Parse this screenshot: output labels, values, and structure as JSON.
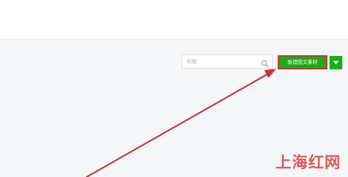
{
  "search": {
    "placeholder": "标题",
    "value": ""
  },
  "toolbar": {
    "new_label": "新建图文素材"
  },
  "icons": {
    "search": "search-icon",
    "dropdown": "caret-down-icon"
  },
  "colors": {
    "primary_green": "#1aad19",
    "highlight_red": "#c0392b",
    "arrow_red": "#cc3333"
  },
  "watermark": {
    "text": "上海红网"
  }
}
